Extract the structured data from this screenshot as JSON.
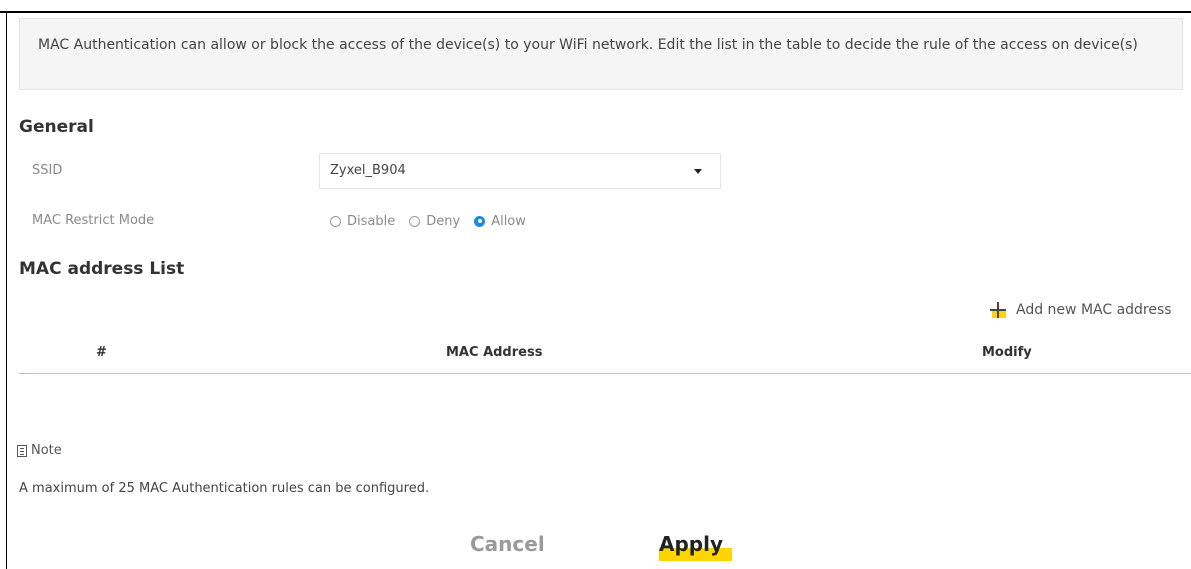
{
  "intro": {
    "text": "MAC Authentication can allow or block the access of the device(s) to your WiFi network. Edit the list in the table to decide the rule of the access on device(s)"
  },
  "general": {
    "title": "General",
    "ssid": {
      "label": "SSID",
      "value": "Zyxel_B904"
    },
    "mac_restrict_mode": {
      "label": "MAC Restrict Mode",
      "options": [
        {
          "label": "Disable",
          "checked": false
        },
        {
          "label": "Deny",
          "checked": false
        },
        {
          "label": "Allow",
          "checked": true
        }
      ]
    }
  },
  "mac_list": {
    "title": "MAC address List",
    "add_label": "Add new MAC address",
    "columns": [
      "#",
      "MAC Address",
      "Modify"
    ],
    "rows": []
  },
  "note": {
    "label": "Note",
    "text": "A maximum of 25 MAC Authentication rules can be configured."
  },
  "buttons": {
    "cancel": "Cancel",
    "apply": "Apply"
  },
  "colors": {
    "accent": "#ffd400",
    "radio_selected": "#1a8ae6",
    "table_line": "#f3c623"
  }
}
